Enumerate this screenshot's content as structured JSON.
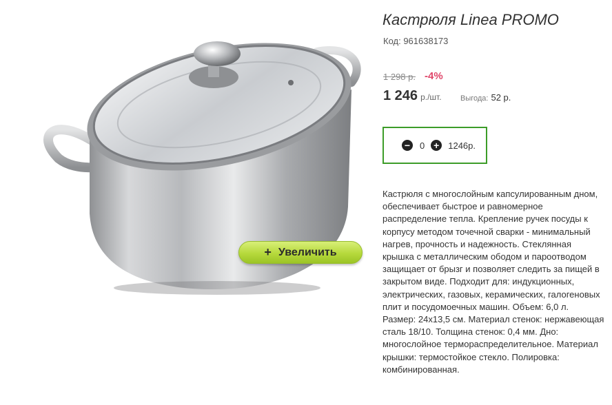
{
  "product": {
    "title": "Кастрюля Linea PROMO",
    "code": "Код: 961638173",
    "old_price": "1 298 р.",
    "discount": "-4%",
    "price": "1 246",
    "price_unit": "р./шт.",
    "savings_label": "Выгода:",
    "savings_value": "52 р.",
    "description": "Кастрюля с многослойным капсулированным дном, обеспечивает быстрое и равномерное распределение тепла. Крепление ручек посуды к корпусу методом точечной сварки - минимальный нагрев, прочность и надежность. Стеклянная крышка с металлическим ободом и пароотводом защищает от брызг и позволяет следить за пищей в закрытом виде. Подходит для: индукционных, электрических, газовых, керамических, галогеновых плит и посудомоечных машин. Объем: 6,0 л. Размер: 24x13,5 см. Материал стенок: нержавеющая сталь 18/10. Толщина стенок: 0,4 мм. Дно: многослойное терморaспределительное. Материал крышки: термостойкое стекло. Полировка: комбинированная."
  },
  "cart": {
    "quantity": "0",
    "sum": "1246р."
  },
  "zoom": {
    "label": "Увеличить",
    "icon": "plus-icon"
  },
  "colors": {
    "discount": "#e0466a",
    "cart_border": "#3c9c28",
    "zoom_button": "#b6d93c"
  }
}
